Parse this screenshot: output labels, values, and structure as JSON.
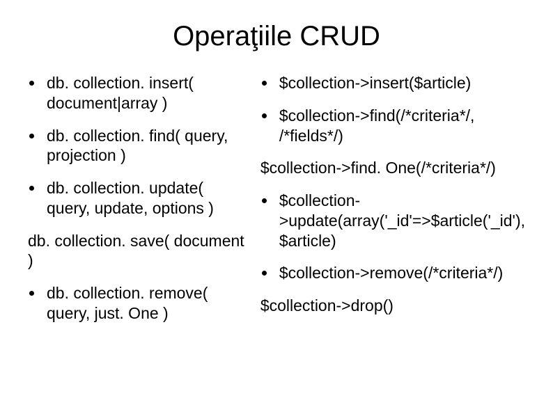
{
  "title": "Operaţiile CRUD",
  "left": {
    "items": [
      {
        "type": "bullet",
        "text": "db. collection. insert( document|array )"
      },
      {
        "type": "bullet",
        "text": "db. collection. find( query, projection )"
      },
      {
        "type": "bullet",
        "text": "db. collection. update( query, update, options )"
      },
      {
        "type": "plain",
        "text": "db. collection. save( document )"
      },
      {
        "type": "bullet",
        "text": "db. collection. remove( query, just. One )"
      }
    ]
  },
  "right": {
    "items": [
      {
        "type": "bullet",
        "text": "$collection->insert($article)"
      },
      {
        "type": "bullet",
        "text": "$collection->find(/*criteria*/, /*fields*/)"
      },
      {
        "type": "plain",
        "text": "$collection->find. One(/*criteria*/)"
      },
      {
        "type": "bullet",
        "text": "$collection->update(array('_id'=>$article('_id'), $article)"
      },
      {
        "type": "bullet",
        "text": "$collection->remove(/*criteria*/)"
      },
      {
        "type": "plain",
        "text": "$collection->drop()"
      }
    ]
  }
}
